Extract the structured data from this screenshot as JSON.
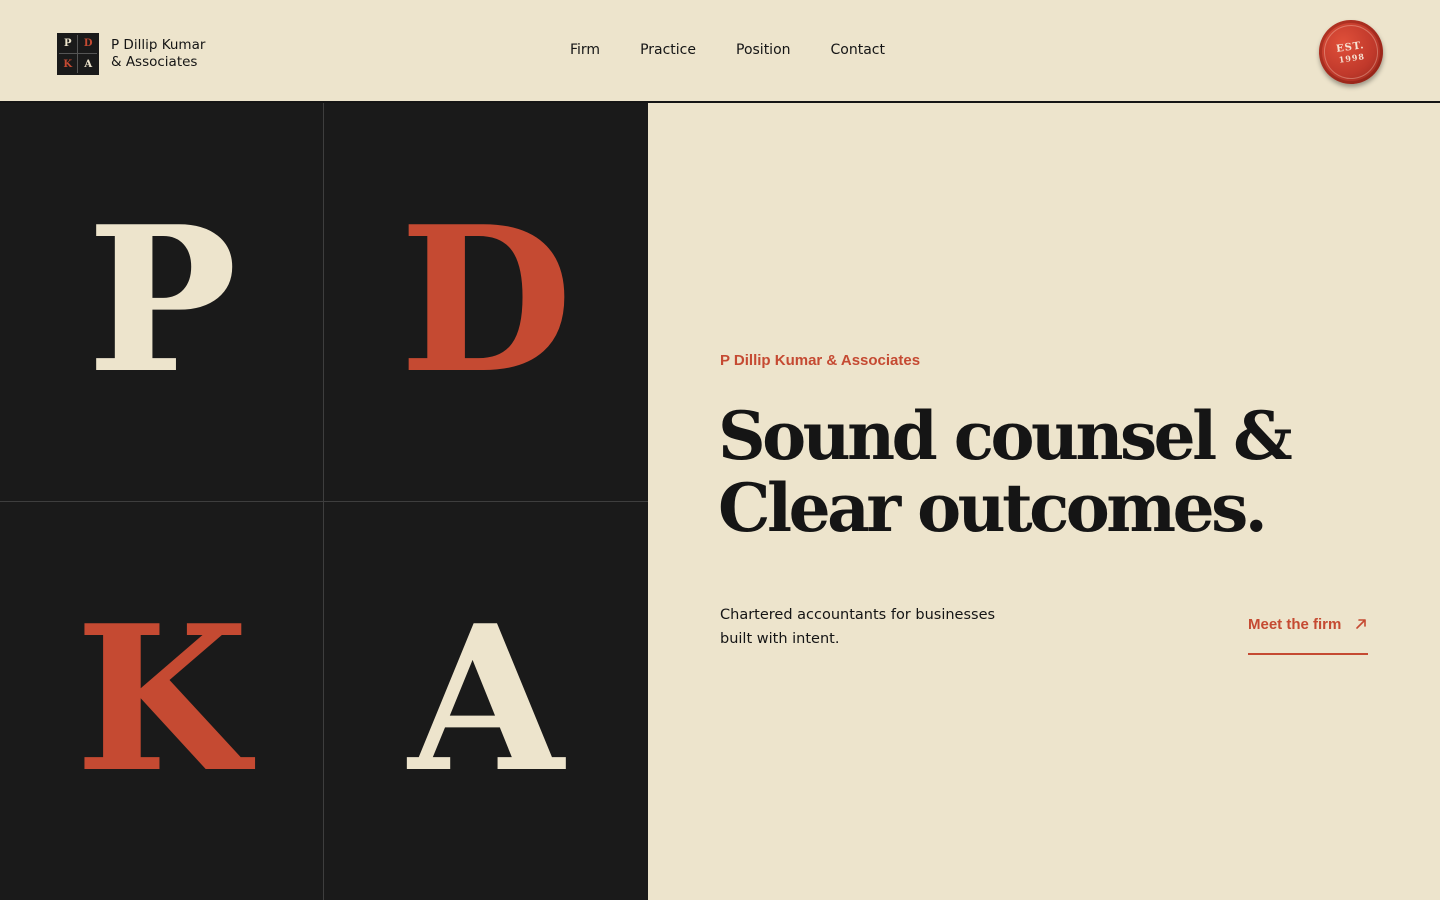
{
  "header": {
    "logo_letters": [
      "P",
      "D",
      "K",
      "A"
    ],
    "brand_line1": "P Dillip Kumar",
    "brand_line2": "& Associates",
    "nav": [
      {
        "label": "Firm"
      },
      {
        "label": "Practice"
      },
      {
        "label": "Position"
      },
      {
        "label": "Contact"
      }
    ],
    "seal": {
      "top": "EST.",
      "bottom": "1998"
    }
  },
  "panel": {
    "letters": [
      "P",
      "D",
      "K",
      "A"
    ]
  },
  "hero": {
    "eyebrow": "P Dillip Kumar & Associates",
    "headline_line1": "Sound counsel &",
    "headline_line2": "Clear outcomes.",
    "subcopy": "Chartered accountants for businesses built with intent.",
    "cta_label": "Meet the firm",
    "cta_icon": "arrow-up-right-icon"
  },
  "colors": {
    "background": "#ede4cc",
    "ink": "#151515",
    "accent": "#c54a32",
    "panel": "#1a1a1a"
  }
}
